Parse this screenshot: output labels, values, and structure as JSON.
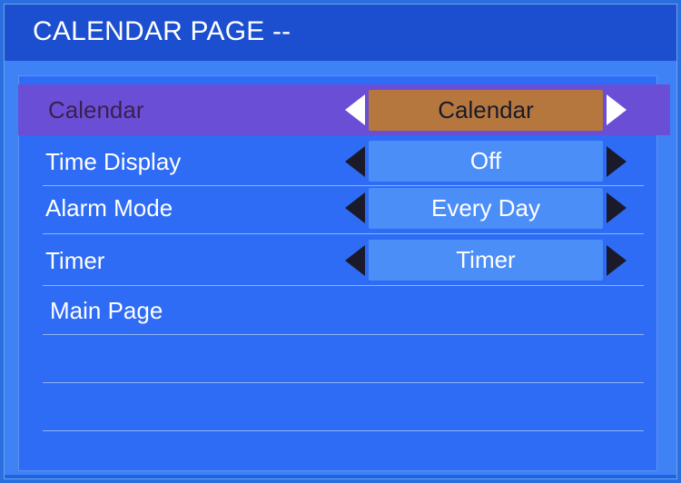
{
  "header": {
    "title": "CALENDAR PAGE --"
  },
  "menu": {
    "items": [
      {
        "label": "Calendar",
        "value": "Calendar",
        "selected": true
      },
      {
        "label": "Time Display",
        "value": "Off"
      },
      {
        "label": "Alarm Mode",
        "value": "Every Day"
      },
      {
        "label": "Timer",
        "value": "Timer"
      },
      {
        "label": "Main Page"
      }
    ]
  },
  "icons": {
    "left": "arrow-left-icon",
    "right": "arrow-right-icon"
  },
  "colors": {
    "background": "#2a6fe0",
    "header": "#1c4fcf",
    "panel": "#3e82f6",
    "selected_row": "#6a4fd6",
    "active_value": "#b5773e",
    "value_box": "#4c8ef8"
  }
}
